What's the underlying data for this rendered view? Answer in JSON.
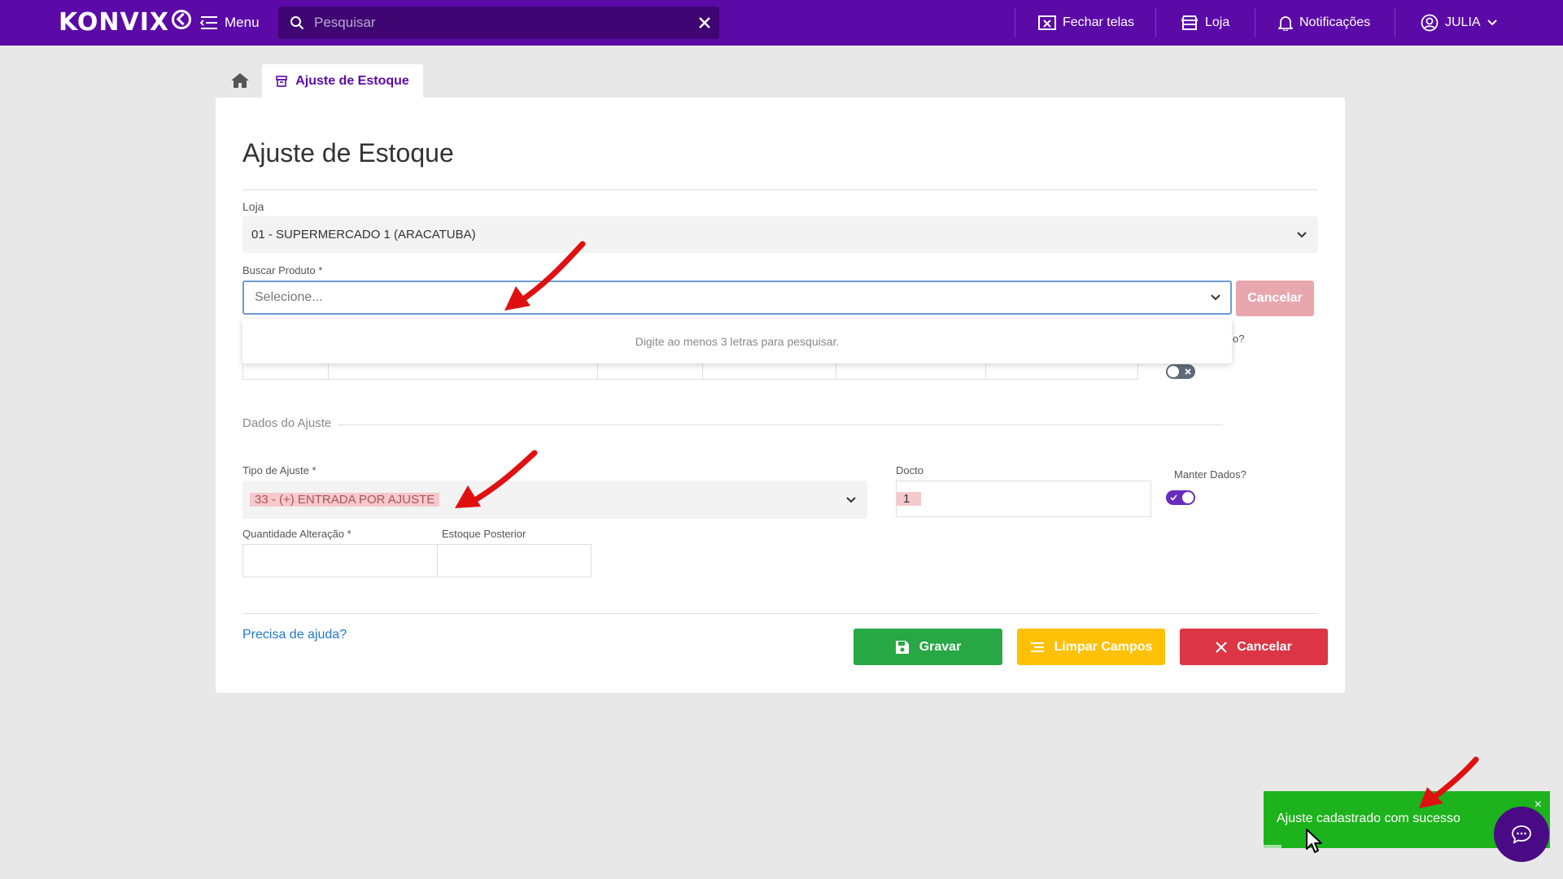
{
  "header": {
    "logo_text": "KONVIX",
    "menu_label": "Menu",
    "search_placeholder": "Pesquisar",
    "close_screens_label": "Fechar telas",
    "store_label": "Loja",
    "notifications_label": "Notificações",
    "user_label": "JULIA"
  },
  "tabs": {
    "active_label": "Ajuste de Estoque"
  },
  "form": {
    "title": "Ajuste de Estoque",
    "store_label": "Loja",
    "store_value": "01 - SUPERMERCADO 1 (ARACATUBA)",
    "product_label": "Buscar Produto *",
    "product_placeholder": "Selecione...",
    "product_cancel_label": "Cancelar",
    "dropdown_hint": "Digite ao menos 3 letras para pesquisar.",
    "partial_label": "o?",
    "section_label": "Dados do Ajuste",
    "adjust_type_label": "Tipo de Ajuste *",
    "adjust_type_value": "33 - (+) ENTRADA POR AJUSTE",
    "docto_label": "Docto",
    "docto_value": "1",
    "keep_data_label": "Manter Dados?",
    "keep_data_on": true,
    "qty_label": "Quantidade Alteração *",
    "qty_value": "",
    "stock_after_label": "Estoque Posterior",
    "stock_after_value": "",
    "help_link": "Precisa de ajuda?",
    "save_label": "Gravar",
    "clear_label": "Limpar Campos",
    "cancel_label": "Cancelar"
  },
  "toast": {
    "message": "Ajuste cadastrado com sucesso",
    "close_symbol": "×"
  },
  "colors": {
    "header": "#5b0aa8",
    "save": "#28a745",
    "clear": "#ffc107",
    "cancel": "#dc3545",
    "toast": "#1db31d",
    "annotation_arrow": "#e01010"
  }
}
